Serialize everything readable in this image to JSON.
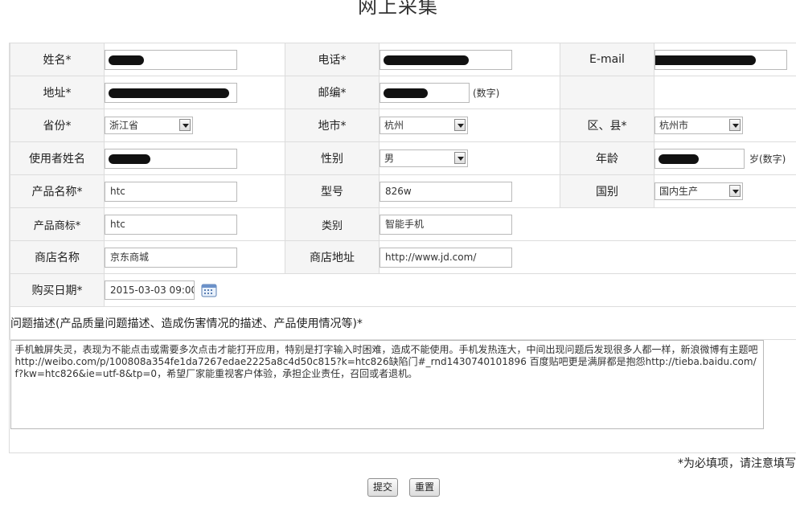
{
  "page": {
    "title": "网上采集"
  },
  "form": {
    "name": {
      "label": "姓名*",
      "value": ""
    },
    "phone": {
      "label": "电话*",
      "value": ""
    },
    "email": {
      "label": "E-mail",
      "value": ""
    },
    "address": {
      "label": "地址*",
      "value": ""
    },
    "postcode": {
      "label": "邮编*",
      "value": "",
      "hint": "(数字)"
    },
    "province": {
      "label": "省份*",
      "selected": "浙江省"
    },
    "city": {
      "label": "地市*",
      "selected": "杭州"
    },
    "district": {
      "label": "区、县*",
      "selected": "杭州市"
    },
    "user_name": {
      "label": "使用者姓名",
      "value": ""
    },
    "gender": {
      "label": "性别",
      "selected": "男"
    },
    "age": {
      "label": "年龄",
      "value": "",
      "hint": "岁(数字)"
    },
    "product_name": {
      "label": "产品名称*",
      "value": "htc"
    },
    "model": {
      "label": "型号",
      "value": "826w"
    },
    "origin": {
      "label": "国别",
      "selected": "国内生产"
    },
    "brand": {
      "label": "产品商标*",
      "value": "htc"
    },
    "category": {
      "label": "类别",
      "value": "智能手机"
    },
    "store_name": {
      "label": "商店名称",
      "value": "京东商城"
    },
    "store_address": {
      "label": "商店地址",
      "value": "http://www.jd.com/"
    },
    "purchase_date": {
      "label": "购买日期*",
      "value": "2015-03-03 09:00"
    },
    "description": {
      "label": "问题描述(产品质量问题描述、造成伤害情况的描述、产品使用情况等)*",
      "value": "手机触屏失灵，表现为不能点击或需要多次点击才能打开应用，特别是打字输入时困难，造成不能使用。手机发热连大，中间出现问题后发现很多人都一样，新浪微博有主题吧http://weibo.com/p/100808a354fe1da7267edae2225a8c4d50c815?k=htc826缺陷门#_rnd1430740101896 百度贴吧更是满屏都是抱怨http://tieba.baidu.com/f?kw=htc826&ie=utf-8&tp=0，希望厂家能重视客户体验，承担企业责任，召回或者退机。"
    }
  },
  "footer": {
    "required_note": "*为必填项，请注意填写",
    "submit_label": "提交",
    "reset_label": "重置"
  }
}
